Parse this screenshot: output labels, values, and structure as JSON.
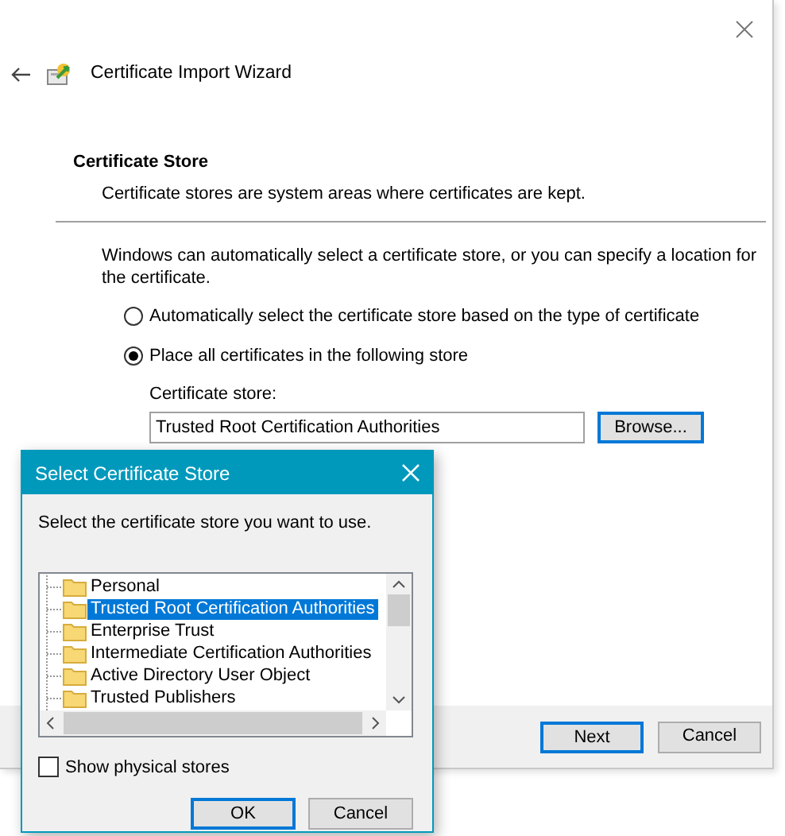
{
  "window": {
    "title": "Certificate Import Wizard"
  },
  "header": {
    "title": "Certificate Store",
    "subtitle": "Certificate stores are system areas where certificates are kept."
  },
  "intro": "Windows can automatically select a certificate store, or you can specify a location for the certificate.",
  "options": [
    {
      "label": "Automatically select the certificate store based on the type of certificate",
      "selected": false
    },
    {
      "label": "Place all certificates in the following store",
      "selected": true
    }
  ],
  "store_field": {
    "label": "Certificate store:",
    "value": "Trusted Root Certification Authorities"
  },
  "browse_button": {
    "label": "Browse...",
    "default": true
  },
  "buttons": [
    {
      "label": "Next",
      "default": true
    },
    {
      "label": "Cancel",
      "default": false
    }
  ],
  "dialog": {
    "title": "Select Certificate Store",
    "prompt": "Select the certificate store you want to use.",
    "stores": [
      {
        "label": "Personal",
        "selected": false
      },
      {
        "label": "Trusted Root Certification Authorities",
        "selected": true
      },
      {
        "label": "Enterprise Trust",
        "selected": false
      },
      {
        "label": "Intermediate Certification Authorities",
        "selected": false
      },
      {
        "label": "Active Directory User Object",
        "selected": false
      },
      {
        "label": "Trusted Publishers",
        "selected": false
      }
    ],
    "show_physical": {
      "label": "Show physical stores",
      "checked": false
    },
    "buttons": [
      {
        "label": "OK",
        "default": true
      },
      {
        "label": "Cancel",
        "default": false
      }
    ]
  }
}
